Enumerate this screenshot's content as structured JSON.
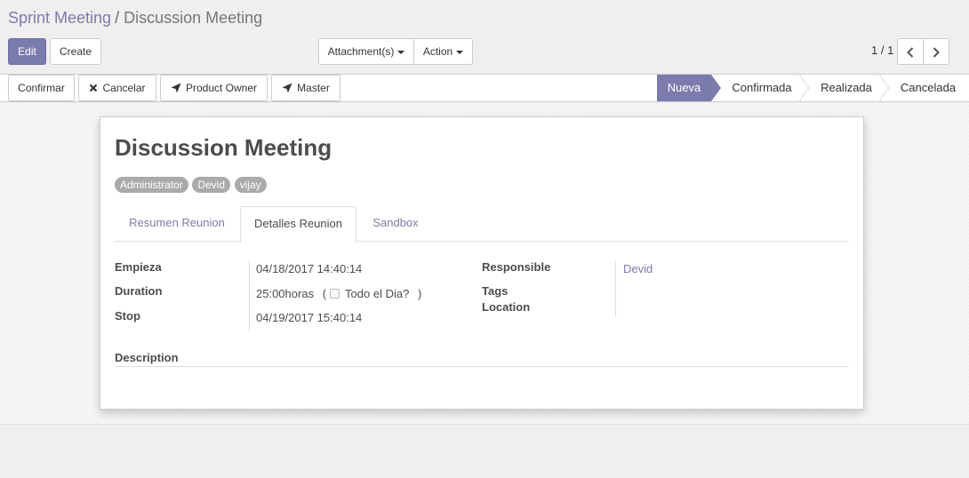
{
  "breadcrumb": {
    "parent": "Sprint Meeting",
    "separator": "/",
    "current": "Discussion Meeting"
  },
  "toolbar": {
    "edit_label": "Edit",
    "create_label": "Create",
    "attachments_label": "Attachment(s)",
    "action_label": "Action"
  },
  "pager": {
    "value": "1 / 1"
  },
  "statusbar": {
    "buttons": [
      {
        "label": "Confirmar",
        "icon": ""
      },
      {
        "label": "Cancelar",
        "icon": "close-icon"
      },
      {
        "label": "Product Owner",
        "icon": "paper-plane-icon"
      },
      {
        "label": "Master",
        "icon": "paper-plane-icon"
      }
    ],
    "stages": [
      "Nueva",
      "Confirmada",
      "Realizada",
      "Cancelada"
    ],
    "active_stage": "Nueva"
  },
  "record": {
    "title": "Discussion Meeting",
    "attendees": [
      "Administrator",
      "Devid",
      "vijay"
    ],
    "tabs": [
      "Resumen Reunion",
      "Detalles Reunion",
      "Sandbox"
    ],
    "active_tab": "Detalles Reunion",
    "fields": {
      "start_label": "Empieza",
      "start_value": "04/18/2017 14:40:14",
      "duration_label": "Duration",
      "duration_value": "25:00",
      "duration_unit": "horas",
      "allday_open": "(",
      "allday_label": "Todo el Dia?",
      "allday_close": ")",
      "allday_checked": false,
      "stop_label": "Stop",
      "stop_value": "04/19/2017 15:40:14",
      "responsible_label": "Responsible",
      "responsible_value": "Devid",
      "tags_label": "Tags",
      "location_label": "Location"
    },
    "description_label": "Description"
  },
  "colors": {
    "brand": "#7c7bad",
    "tag_bg": "#aaaaaa",
    "background": "#f0eeee"
  }
}
